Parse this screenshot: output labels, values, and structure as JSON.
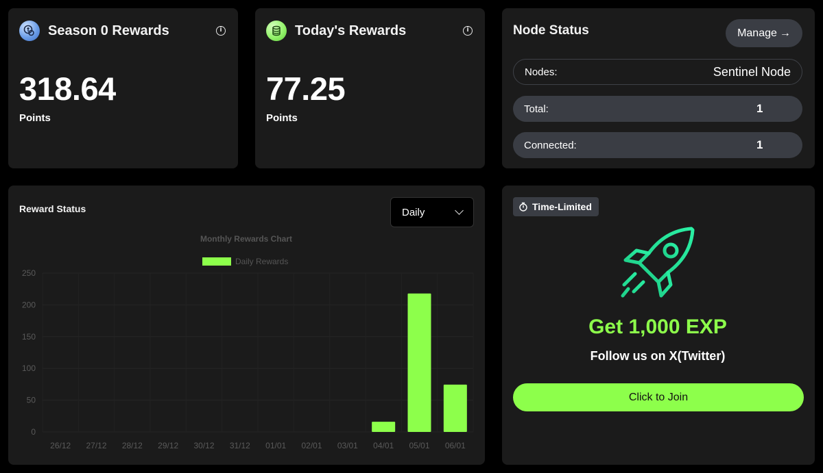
{
  "season_card": {
    "title": "Season 0 Rewards",
    "value": "318.64",
    "unit": "Points",
    "icon": "season-coin-icon"
  },
  "today_card": {
    "title": "Today's Rewards",
    "value": "77.25",
    "unit": "Points",
    "icon": "coin-stack-icon"
  },
  "node_status": {
    "title": "Node Status",
    "manage_label": "Manage",
    "manage_arrow": "→",
    "rows": [
      {
        "label": "Nodes:",
        "value": "Sentinel Node"
      },
      {
        "label": "Total:",
        "value": "1"
      },
      {
        "label": "Connected:",
        "value": "1"
      }
    ]
  },
  "reward_status": {
    "title": "Reward Status",
    "period_select": {
      "selected": "Daily"
    }
  },
  "chart_data": {
    "type": "bar",
    "title": "Monthly Rewards Chart",
    "categories": [
      "26/12",
      "27/12",
      "28/12",
      "29/12",
      "30/12",
      "31/12",
      "01/01",
      "02/01",
      "03/01",
      "04/01",
      "05/01",
      "06/01"
    ],
    "series": [
      {
        "name": "Daily Rewards",
        "values": [
          0,
          0,
          0,
          0,
          0,
          0,
          0,
          0,
          0,
          16,
          218,
          74.5
        ]
      }
    ],
    "ylim": [
      0,
      250
    ],
    "yticks": [
      0,
      50,
      100,
      150,
      200,
      250
    ],
    "grid": true,
    "legend": "top-center",
    "bar_color": "#8dff4b"
  },
  "promo": {
    "badge": "Time-Limited",
    "title": "Get 1,000 EXP",
    "subtitle": "Follow us on X(Twitter)",
    "button": "Click to Join",
    "accent": "#8dff4b",
    "icon": "rocket-icon"
  }
}
